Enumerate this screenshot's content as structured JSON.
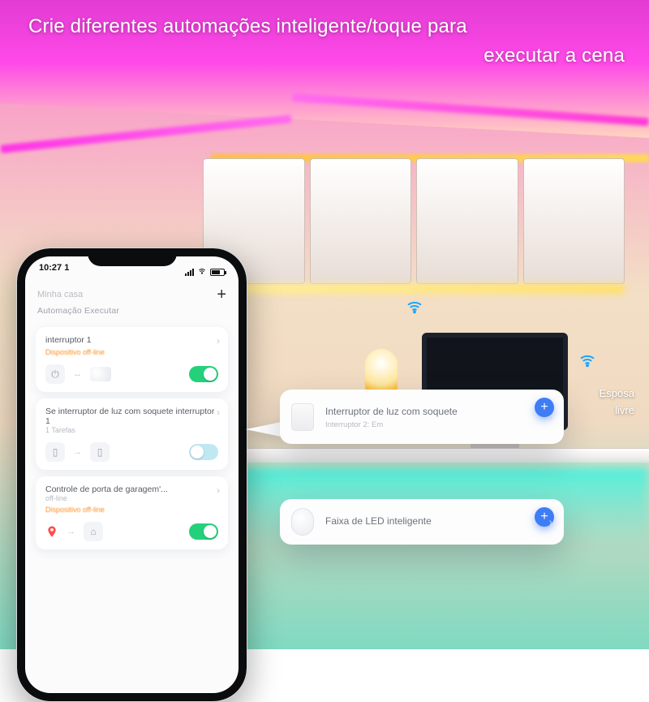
{
  "headline": {
    "line1": "Crie diferentes automações inteligente/toque para",
    "line2": "executar a cena"
  },
  "side_labels": {
    "a": "Esposa",
    "b": "livre"
  },
  "phone": {
    "status": {
      "time": "10:27 1"
    },
    "app_title": "Minha casa",
    "tabs_label": "Automação Executar",
    "cards": [
      {
        "title": "interruptor 1",
        "offline": "Dispositivo off-line",
        "toggle_on": true
      },
      {
        "title": "Se interruptor de luz com soquete interruptor 1",
        "sub": "1 Tarefas",
        "toggle_on": false
      },
      {
        "title": "Controle de porta de garagem'...",
        "sub": "off-line",
        "offline": "Dispositivo off-line",
        "toggle_on": true
      }
    ]
  },
  "popouts": {
    "a": {
      "title": "Interruptor de luz com soquete",
      "sub": "Interruptor 2: Em"
    },
    "b": {
      "title": "Faixa de LED inteligente",
      "sub": ""
    }
  }
}
